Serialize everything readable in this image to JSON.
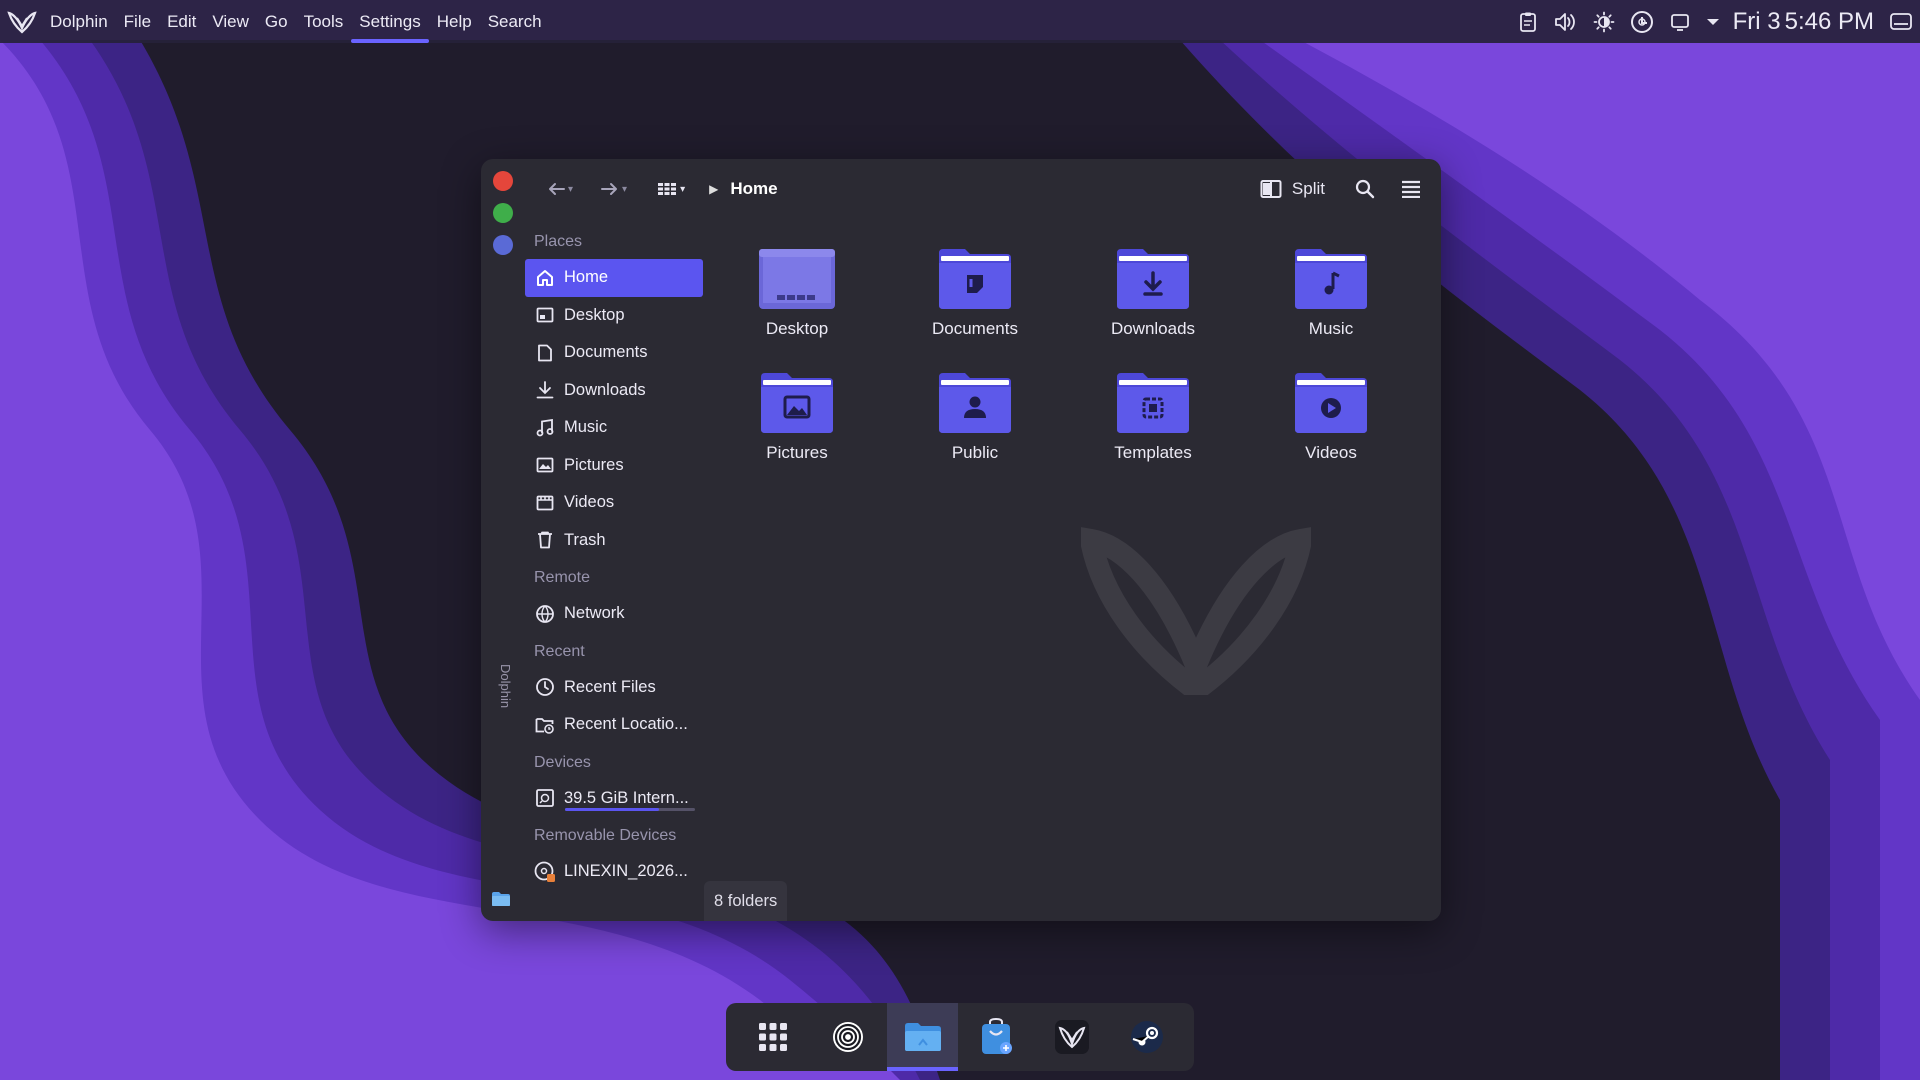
{
  "top_panel": {
    "menu": [
      {
        "label": "Dolphin"
      },
      {
        "label": "File"
      },
      {
        "label": "Edit"
      },
      {
        "label": "View"
      },
      {
        "label": "Go"
      },
      {
        "label": "Tools"
      },
      {
        "label": "Settings",
        "active": true
      },
      {
        "label": "Help"
      },
      {
        "label": "Search"
      }
    ],
    "tray": {
      "icons": [
        "clipboard-icon",
        "volume-icon",
        "brightness-icon",
        "network-icon",
        "display-icon",
        "chevron-down-icon"
      ],
      "date": "Fri 3",
      "time": "5:46 PM"
    }
  },
  "window": {
    "side_label": "Dolphin",
    "toolbar": {
      "view_mode_icon": "grid-icon",
      "breadcrumb": "Home",
      "split_label": "Split"
    },
    "sidebar": {
      "sections": [
        {
          "title": "Places",
          "items": [
            {
              "label": "Home",
              "icon": "home-icon",
              "selected": true
            },
            {
              "label": "Desktop",
              "icon": "desktop-icon"
            },
            {
              "label": "Documents",
              "icon": "document-icon"
            },
            {
              "label": "Downloads",
              "icon": "download-icon"
            },
            {
              "label": "Music",
              "icon": "music-icon"
            },
            {
              "label": "Pictures",
              "icon": "picture-icon"
            },
            {
              "label": "Videos",
              "icon": "video-icon"
            },
            {
              "label": "Trash",
              "icon": "trash-icon"
            }
          ]
        },
        {
          "title": "Remote",
          "items": [
            {
              "label": "Network",
              "icon": "network-icon"
            }
          ]
        },
        {
          "title": "Recent",
          "items": [
            {
              "label": "Recent Files",
              "icon": "clock-icon"
            },
            {
              "label": "Recent Locatio...",
              "icon": "folder-clock-icon"
            }
          ]
        },
        {
          "title": "Devices",
          "items": [
            {
              "label": "39.5 GiB Intern...",
              "icon": "drive-icon",
              "usage_fraction": 0.72
            }
          ]
        },
        {
          "title": "Removable Devices",
          "items": [
            {
              "label": "LINEXIN_2026...",
              "icon": "disc-icon"
            }
          ]
        }
      ]
    },
    "folders": [
      {
        "name": "Desktop",
        "icon": "desktop-folder-icon"
      },
      {
        "name": "Documents",
        "icon": "documents-folder-icon"
      },
      {
        "name": "Downloads",
        "icon": "downloads-folder-icon"
      },
      {
        "name": "Music",
        "icon": "music-folder-icon"
      },
      {
        "name": "Pictures",
        "icon": "pictures-folder-icon"
      },
      {
        "name": "Public",
        "icon": "public-folder-icon"
      },
      {
        "name": "Templates",
        "icon": "templates-folder-icon"
      },
      {
        "name": "Videos",
        "icon": "videos-folder-icon"
      }
    ],
    "status": "8 folders"
  },
  "dock": {
    "items": [
      "app-grid-icon",
      "settings-spiral-icon",
      "files-icon",
      "store-icon",
      "linexin-icon",
      "steam-icon"
    ],
    "active_index": 2
  },
  "colors": {
    "accent": "#5b55f0",
    "window_bg": "#2b2a33",
    "folder_blue": "#5d59ea"
  }
}
